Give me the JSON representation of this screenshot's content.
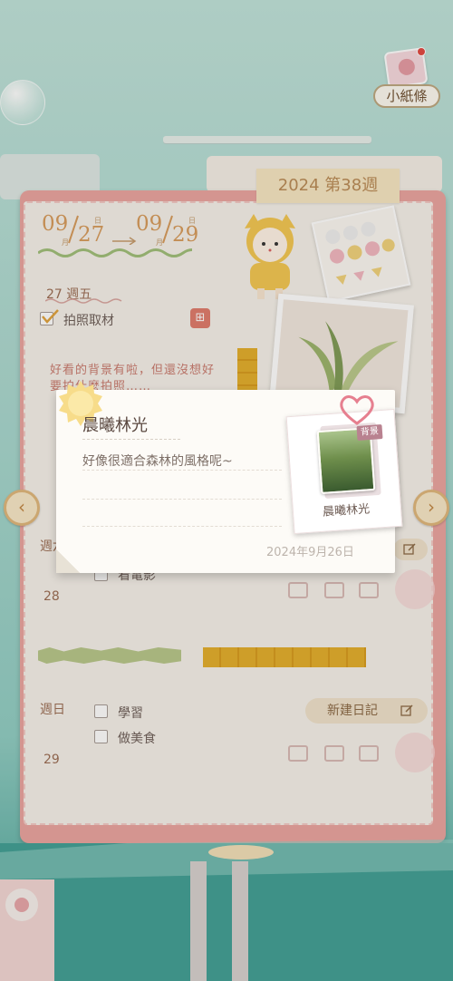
{
  "header": {
    "note_label": "小紙條"
  },
  "planner": {
    "week_tab": "2024 第38週",
    "date_range": {
      "start_month": "09",
      "start_day": "27",
      "end_month": "09",
      "end_day": "29",
      "unit_month": "月",
      "unit_day": "日"
    },
    "days": [
      {
        "label": "27 週五",
        "tasks": [
          {
            "label": "拍照取材",
            "checked": true
          }
        ],
        "note": "好看的背景有啦，但還沒想好要拍什麼拍照……"
      },
      {
        "label": "週六",
        "number": "28",
        "tasks": [
          {
            "label": "看電影",
            "checked": false
          }
        ]
      },
      {
        "label": "週日",
        "number": "29",
        "tasks": [
          {
            "label": "學習",
            "checked": false
          },
          {
            "label": "做美食",
            "checked": false
          }
        ],
        "new_diary_label": "新建日記"
      }
    ]
  },
  "popup": {
    "title": "晨曦林光",
    "description": "好像很適合森林的風格呢~",
    "date": "2024年9月26日",
    "item": {
      "badge": "背景",
      "name": "晨曦林光"
    }
  },
  "navigation": {
    "prev": "‹",
    "next": "›"
  },
  "colors": {
    "planner_border": "#eaa39f",
    "page_bg": "#f5f1ea",
    "accent_gold": "#d69a5a",
    "tab_bg": "#f6e6c2"
  }
}
